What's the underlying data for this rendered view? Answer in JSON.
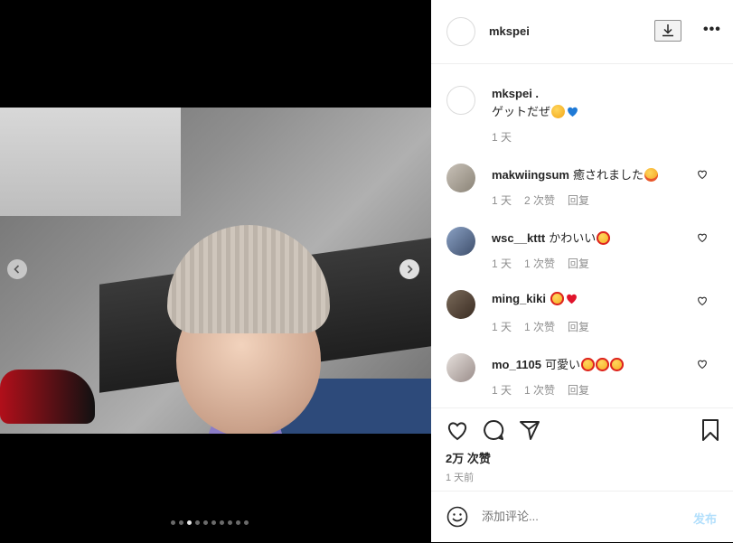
{
  "post": {
    "username": "mkspei",
    "likes": "2万 次赞",
    "time": "1 天前"
  },
  "caption": {
    "username": "mkspei .",
    "text": "ゲットだぜ",
    "meta": "1 天"
  },
  "comments": [
    {
      "user": "makwiingsum",
      "text": "癒されました",
      "time": "1 天",
      "likes": "2 次赞",
      "reply": "回复"
    },
    {
      "user": "wsc__kttt",
      "text": "かわいい",
      "time": "1 天",
      "likes": "1 次赞",
      "reply": "回复"
    },
    {
      "user": "ming_kiki",
      "text": "",
      "time": "1 天",
      "likes": "1 次赞",
      "reply": "回复"
    },
    {
      "user": "mo_1105",
      "text": "可愛い",
      "time": "1 天",
      "likes": "1 次赞",
      "reply": "回复"
    }
  ],
  "add_comment": {
    "placeholder": "添加评论...",
    "post_label": "发布"
  },
  "carousel": {
    "count": 10,
    "active_index": 2
  },
  "colors": {
    "post_disabled": "#b2dffc",
    "meta_gray": "#8e8e8e"
  }
}
